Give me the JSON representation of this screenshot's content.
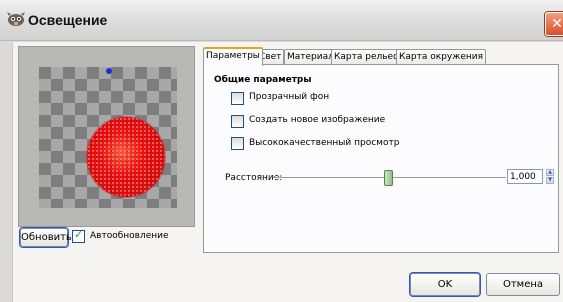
{
  "window": {
    "title": "Освещение",
    "close_symbol": "✕"
  },
  "preview": {
    "update_button": "Обновить",
    "auto_update_label": "Автообновление",
    "auto_update_checked": true
  },
  "tabs": [
    {
      "label": "Параметры",
      "active": true
    },
    {
      "label": "Свет",
      "active": false
    },
    {
      "label": "Материал",
      "active": false
    },
    {
      "label": "Карта рельефа",
      "active": false
    },
    {
      "label": "Карта окружения",
      "active": false
    }
  ],
  "parameters": {
    "group_title": "Общие параметры",
    "options": [
      {
        "label": "Прозрачный фон",
        "checked": false
      },
      {
        "label": "Создать новое изображение",
        "checked": false
      },
      {
        "label": "Высококачественный просмотр",
        "checked": false
      }
    ],
    "distance_label": "Расстояние:",
    "distance_value": "1,000"
  },
  "footer": {
    "ok_label": "OK",
    "cancel_label": "Отмена"
  },
  "colors": {
    "sphere": "#e01010",
    "light_marker": "#1a2fd8",
    "active_tab_accent": "#e8a030"
  }
}
